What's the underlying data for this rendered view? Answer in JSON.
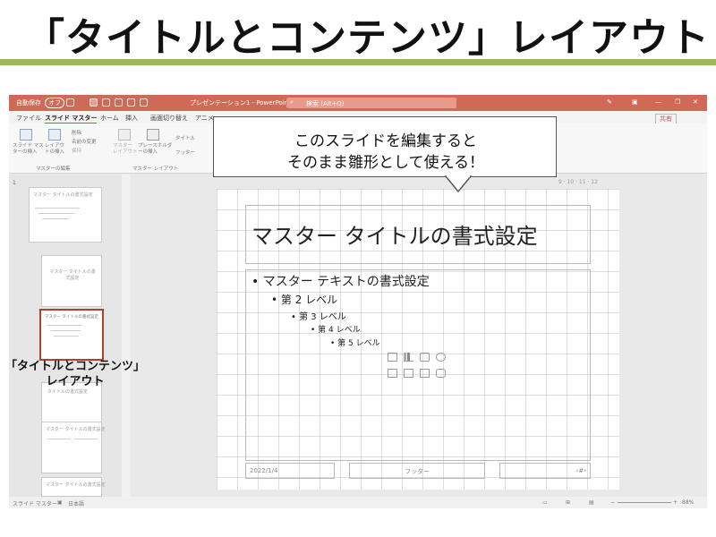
{
  "page": {
    "heading": "「タイトルとコンテンツ」レイアウト",
    "accent_color": "#9bbb59"
  },
  "window": {
    "autosave": "自動保存",
    "autosave_state": "オフ",
    "doc_title": "プレゼンテーション1 - PowerPoint",
    "search_placeholder": "検索 (Alt+Q)",
    "share": "共有",
    "tabs": [
      "ファイル",
      "スライド マスター",
      "ホーム",
      "挿入",
      "画面切り替え",
      "アニメ"
    ],
    "ribbon": {
      "insert_master": "スライド マスターの挿入",
      "insert_layout": "レイアウトの挿入",
      "delete": "削除",
      "rename": "名前の変更",
      "preserve": "保持",
      "master_layout": "マスター レイアウト",
      "insert_placeholder": "プレースホルダーの挿入",
      "title_check": "タイトル",
      "footer_check": "フッター",
      "group_edit": "マスターの編集",
      "group_layout": "マスター レイアウト"
    },
    "status_left": "スライド マスター",
    "status_lang": "日本語",
    "zoom": "88%"
  },
  "thumbnails": {
    "slide_number": "1",
    "master_title": "マスター タイトルの書式設定",
    "layout2_title": "マスター タイトルの書式設定",
    "selected_title": "マスター タイトルの書式設定",
    "layout4_title": "タイトルの書式設定",
    "layout5_title": "マスター タイトルの書式設定",
    "layout6_title": "マスター タイトルの書式設定"
  },
  "slide": {
    "title": "マスター タイトルの書式設定",
    "levels": [
      "マスター テキストの書式設定",
      "第 2 レベル",
      "第 3 レベル",
      "第 4 レベル",
      "第 5 レベル"
    ],
    "date": "2022/1/4",
    "footer": "フッター",
    "page_no": "‹#›",
    "ruler": "9 · 10 · 11 · 12"
  },
  "callout": {
    "line1": "このスライドを編集すると",
    "line2": "そのまま雛形として使える！"
  },
  "layout_label": {
    "line1": "「タイトルとコンテンツ」",
    "line2": "レイアウト"
  },
  "colors": {
    "titlebar": "#cf6a56",
    "selected_border": "#b0422b"
  }
}
